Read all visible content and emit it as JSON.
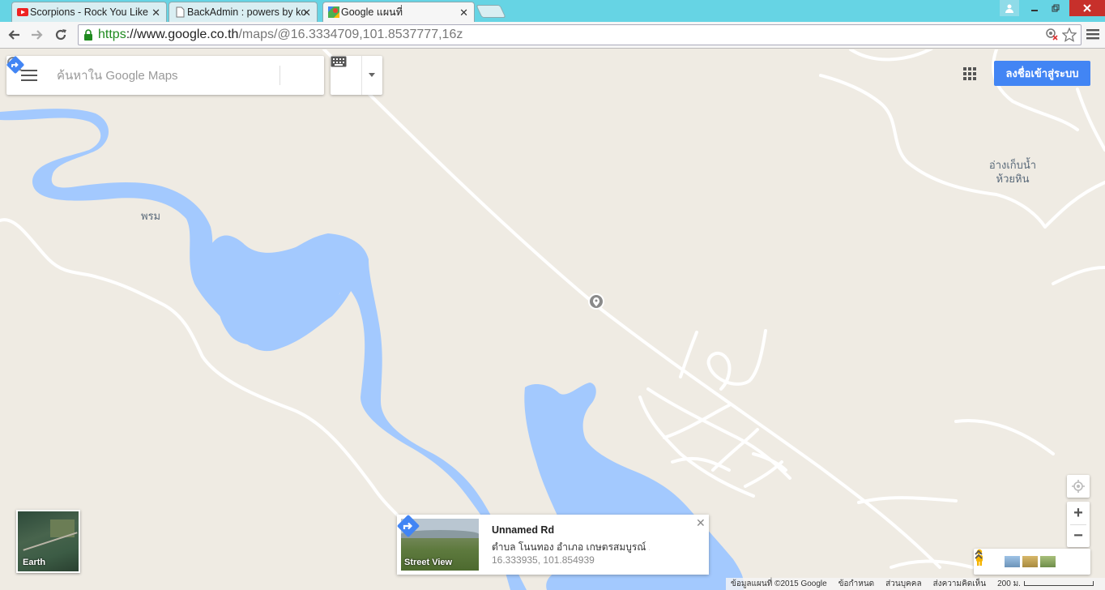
{
  "browser": {
    "tabs": [
      {
        "title": "Scorpions - Rock You Like",
        "favicon": "youtube-icon",
        "active": false
      },
      {
        "title": "BackAdmin : powers by ko",
        "favicon": "page-icon",
        "active": false
      },
      {
        "title": "Google แผนที่",
        "favicon": "google-maps-icon",
        "active": true
      }
    ],
    "close_glyph": "✕",
    "url_https": "https",
    "url_host": "://www.google.co.th",
    "url_path": "/maps/@16.3334709,101.8537777,16z"
  },
  "colors": {
    "water": "#a3c9fe",
    "land": "#efebe3",
    "road": "#ffffff",
    "accent": "#4285f4",
    "tabstrip": "#66d4e4"
  },
  "search": {
    "placeholder": "ค้นหาใน Google Maps"
  },
  "map_labels": {
    "river": "พรม",
    "reservoir_line1": "อ่างเก็บน้ำ",
    "reservoir_line2": "ห้วยหิน"
  },
  "header": {
    "signin_label": "ลงชื่อเข้าสู่ระบบ"
  },
  "earth": {
    "label": "Earth"
  },
  "infocard": {
    "thumb_label": "Street View",
    "title": "Unnamed Rd",
    "address": "ตำบล โนนทอง อำเภอ เกษตรสมบูรณ์ ...",
    "coords": "16.333935, 101.854939"
  },
  "controls": {
    "zoom_in": "+",
    "zoom_out": "−"
  },
  "footer": {
    "map_data": "ข้อมูลแผนที่ ©2015 Google",
    "terms": "ข้อกำหนด",
    "privacy": "ส่วนบุคคล",
    "feedback": "ส่งความคิดเห็น",
    "scale": "200 ม."
  }
}
